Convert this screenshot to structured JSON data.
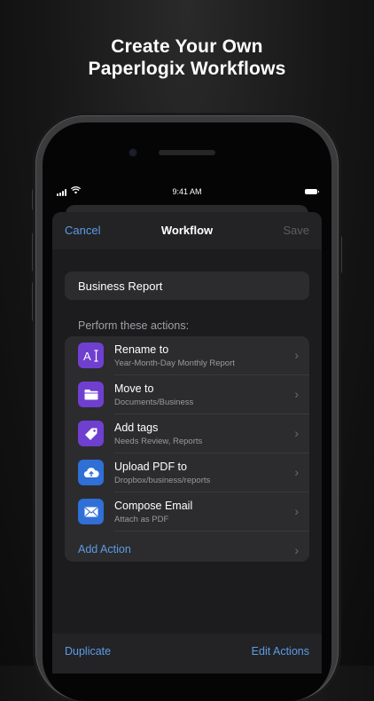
{
  "headline": {
    "line1": "Create Your Own",
    "line2": "Paperlogix Workflows"
  },
  "status_bar": {
    "time": "9:41 AM"
  },
  "nav": {
    "cancel": "Cancel",
    "title": "Workflow",
    "save": "Save"
  },
  "workflow": {
    "name": "Business Report"
  },
  "section": {
    "title": "Perform these actions:"
  },
  "actions": [
    {
      "label": "Rename to",
      "detail": "Year-Month-Day Monthly Report",
      "icon": "rename-icon",
      "color": "#6f3fd0"
    },
    {
      "label": "Move to",
      "detail": "Documents/Business",
      "icon": "folder-icon",
      "color": "#6f3fd0"
    },
    {
      "label": "Add tags",
      "detail": "Needs Review, Reports",
      "icon": "tag-icon",
      "color": "#6f3fd0"
    },
    {
      "label": "Upload PDF to",
      "detail": "Dropbox/business/reports",
      "icon": "cloud-upload-icon",
      "color": "#2f6fd6"
    },
    {
      "label": "Compose Email",
      "detail": "Attach as PDF",
      "icon": "mail-icon",
      "color": "#2f6fd6"
    }
  ],
  "add_action": {
    "label": "Add Action"
  },
  "toolbar": {
    "duplicate": "Duplicate",
    "edit_actions": "Edit Actions"
  },
  "colors": {
    "accent": "#5b9be8",
    "sheet_bg": "#1c1c1e",
    "cell_bg": "#2c2c2e"
  }
}
